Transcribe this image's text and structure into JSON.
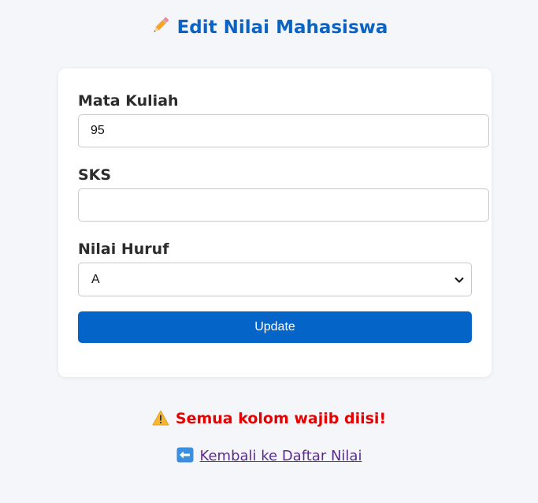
{
  "page": {
    "title": "Edit Nilai Mahasiswa"
  },
  "form": {
    "mata_kuliah": {
      "label": "Mata Kuliah",
      "value": "95"
    },
    "sks": {
      "label": "SKS",
      "value": ""
    },
    "nilai_huruf": {
      "label": "Nilai Huruf",
      "selected": "A"
    },
    "submit_label": "Update"
  },
  "alert": {
    "message": "Semua kolom wajib diisi!",
    "icon": "warning-icon"
  },
  "nav": {
    "back_label": "Kembali ke Daftar Nilai",
    "icon": "left-arrow-icon"
  },
  "colors": {
    "primary": "#0564c8",
    "title": "#0b63c4",
    "error": "#e60000",
    "link": "#5b2d8e",
    "background": "#f4f6f9"
  }
}
